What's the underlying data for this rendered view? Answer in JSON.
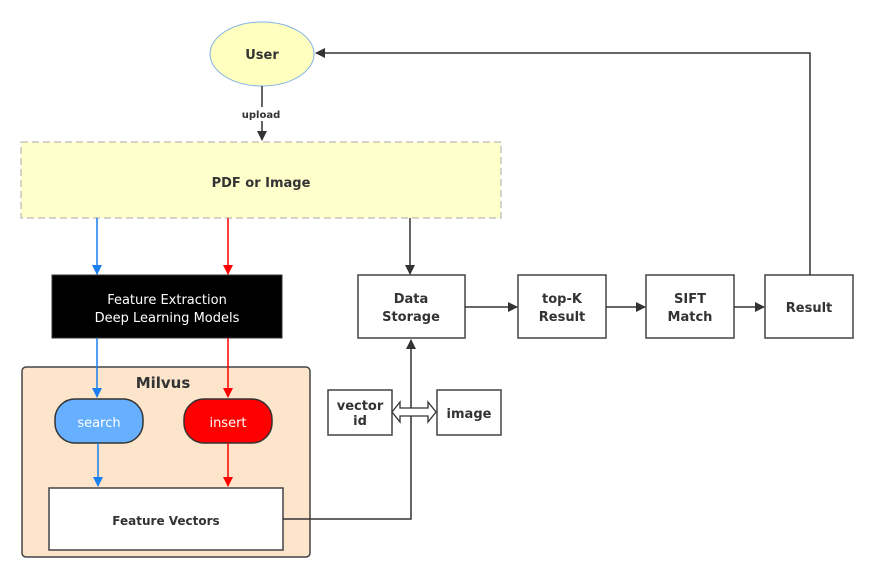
{
  "nodes": {
    "user": "User",
    "upload": "upload",
    "pdf": "PDF or Image",
    "feature_extraction": [
      "Feature Extraction",
      "Deep Learning Models"
    ],
    "milvus": "Milvus",
    "search": "search",
    "insert": "insert",
    "feature_vectors": "Feature Vectors",
    "data_storage": [
      "Data",
      "Storage"
    ],
    "vector_id": [
      "vector",
      "id"
    ],
    "image": "image",
    "topk": [
      "top-K",
      "Result"
    ],
    "sift": [
      "SIFT",
      "Match"
    ],
    "result": "Result"
  },
  "colors": {
    "search_flow": "#1a7ff0",
    "insert_flow": "#ff0000",
    "search_fill": "#66b0ff",
    "insert_fill": "#ff0000",
    "milvus_fill": "#fde5cc",
    "pdf_fill": "#ffffcc",
    "user_fill": "#ffffc0",
    "line": "#333333"
  }
}
